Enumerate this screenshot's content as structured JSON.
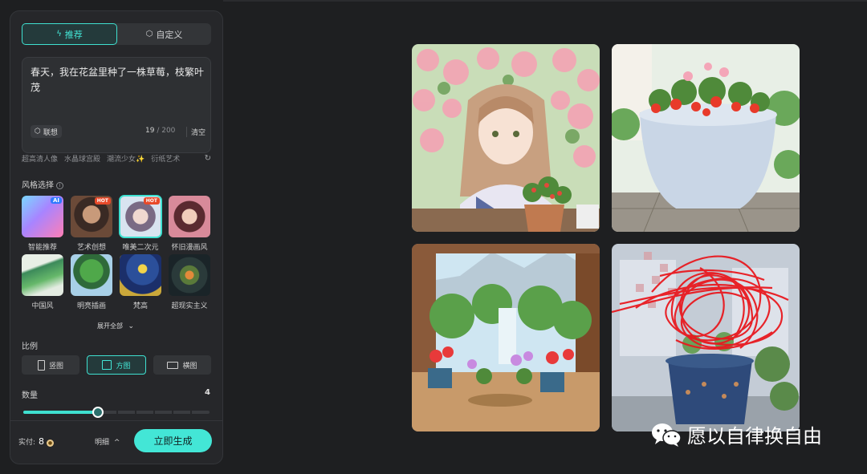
{
  "tabs": [
    {
      "label": "推荐",
      "icon": "sparkle-icon",
      "active": true
    },
    {
      "label": "自定义",
      "icon": "hexagon-icon",
      "active": false
    }
  ],
  "prompt": {
    "text": "春天，我在花盆里种了一株草莓，枝繁叶茂",
    "assoc_label": "联想",
    "count": "19",
    "max": "/ 200",
    "clear_label": "清空"
  },
  "suggestions": [
    "超高清人像",
    "水晶球宫殿",
    "潮流少女✨",
    "衍纸艺术"
  ],
  "style_section": {
    "title": "风格选择"
  },
  "styles": [
    {
      "label": "智能推荐",
      "badge": "AI",
      "selected": false
    },
    {
      "label": "艺术创想",
      "badge": "HOT",
      "selected": false
    },
    {
      "label": "唯美二次元",
      "badge": "HOT",
      "selected": true
    },
    {
      "label": "怀旧漫画风",
      "badge": "",
      "selected": false
    },
    {
      "label": "中国风",
      "badge": "",
      "selected": false
    },
    {
      "label": "明亮插画",
      "badge": "",
      "selected": false
    },
    {
      "label": "梵高",
      "badge": "",
      "selected": false
    },
    {
      "label": "超现实主义",
      "badge": "",
      "selected": false
    }
  ],
  "expand_label": "展开全部",
  "ratio": {
    "title": "比例",
    "options": [
      {
        "label": "竖图",
        "active": false
      },
      {
        "label": "方图",
        "active": true
      },
      {
        "label": "横图",
        "active": false
      }
    ]
  },
  "quantity": {
    "title": "数量",
    "value": "4",
    "fraction": 0.4
  },
  "footer": {
    "cost_label": "实付:",
    "cost_value": "8",
    "detail_label": "明细",
    "generate_label": "立即生成"
  },
  "watermark": "愿以自律换自由",
  "colors": {
    "accent": "#43e6d6",
    "panel": "#26272a",
    "background": "#1e1f21"
  }
}
